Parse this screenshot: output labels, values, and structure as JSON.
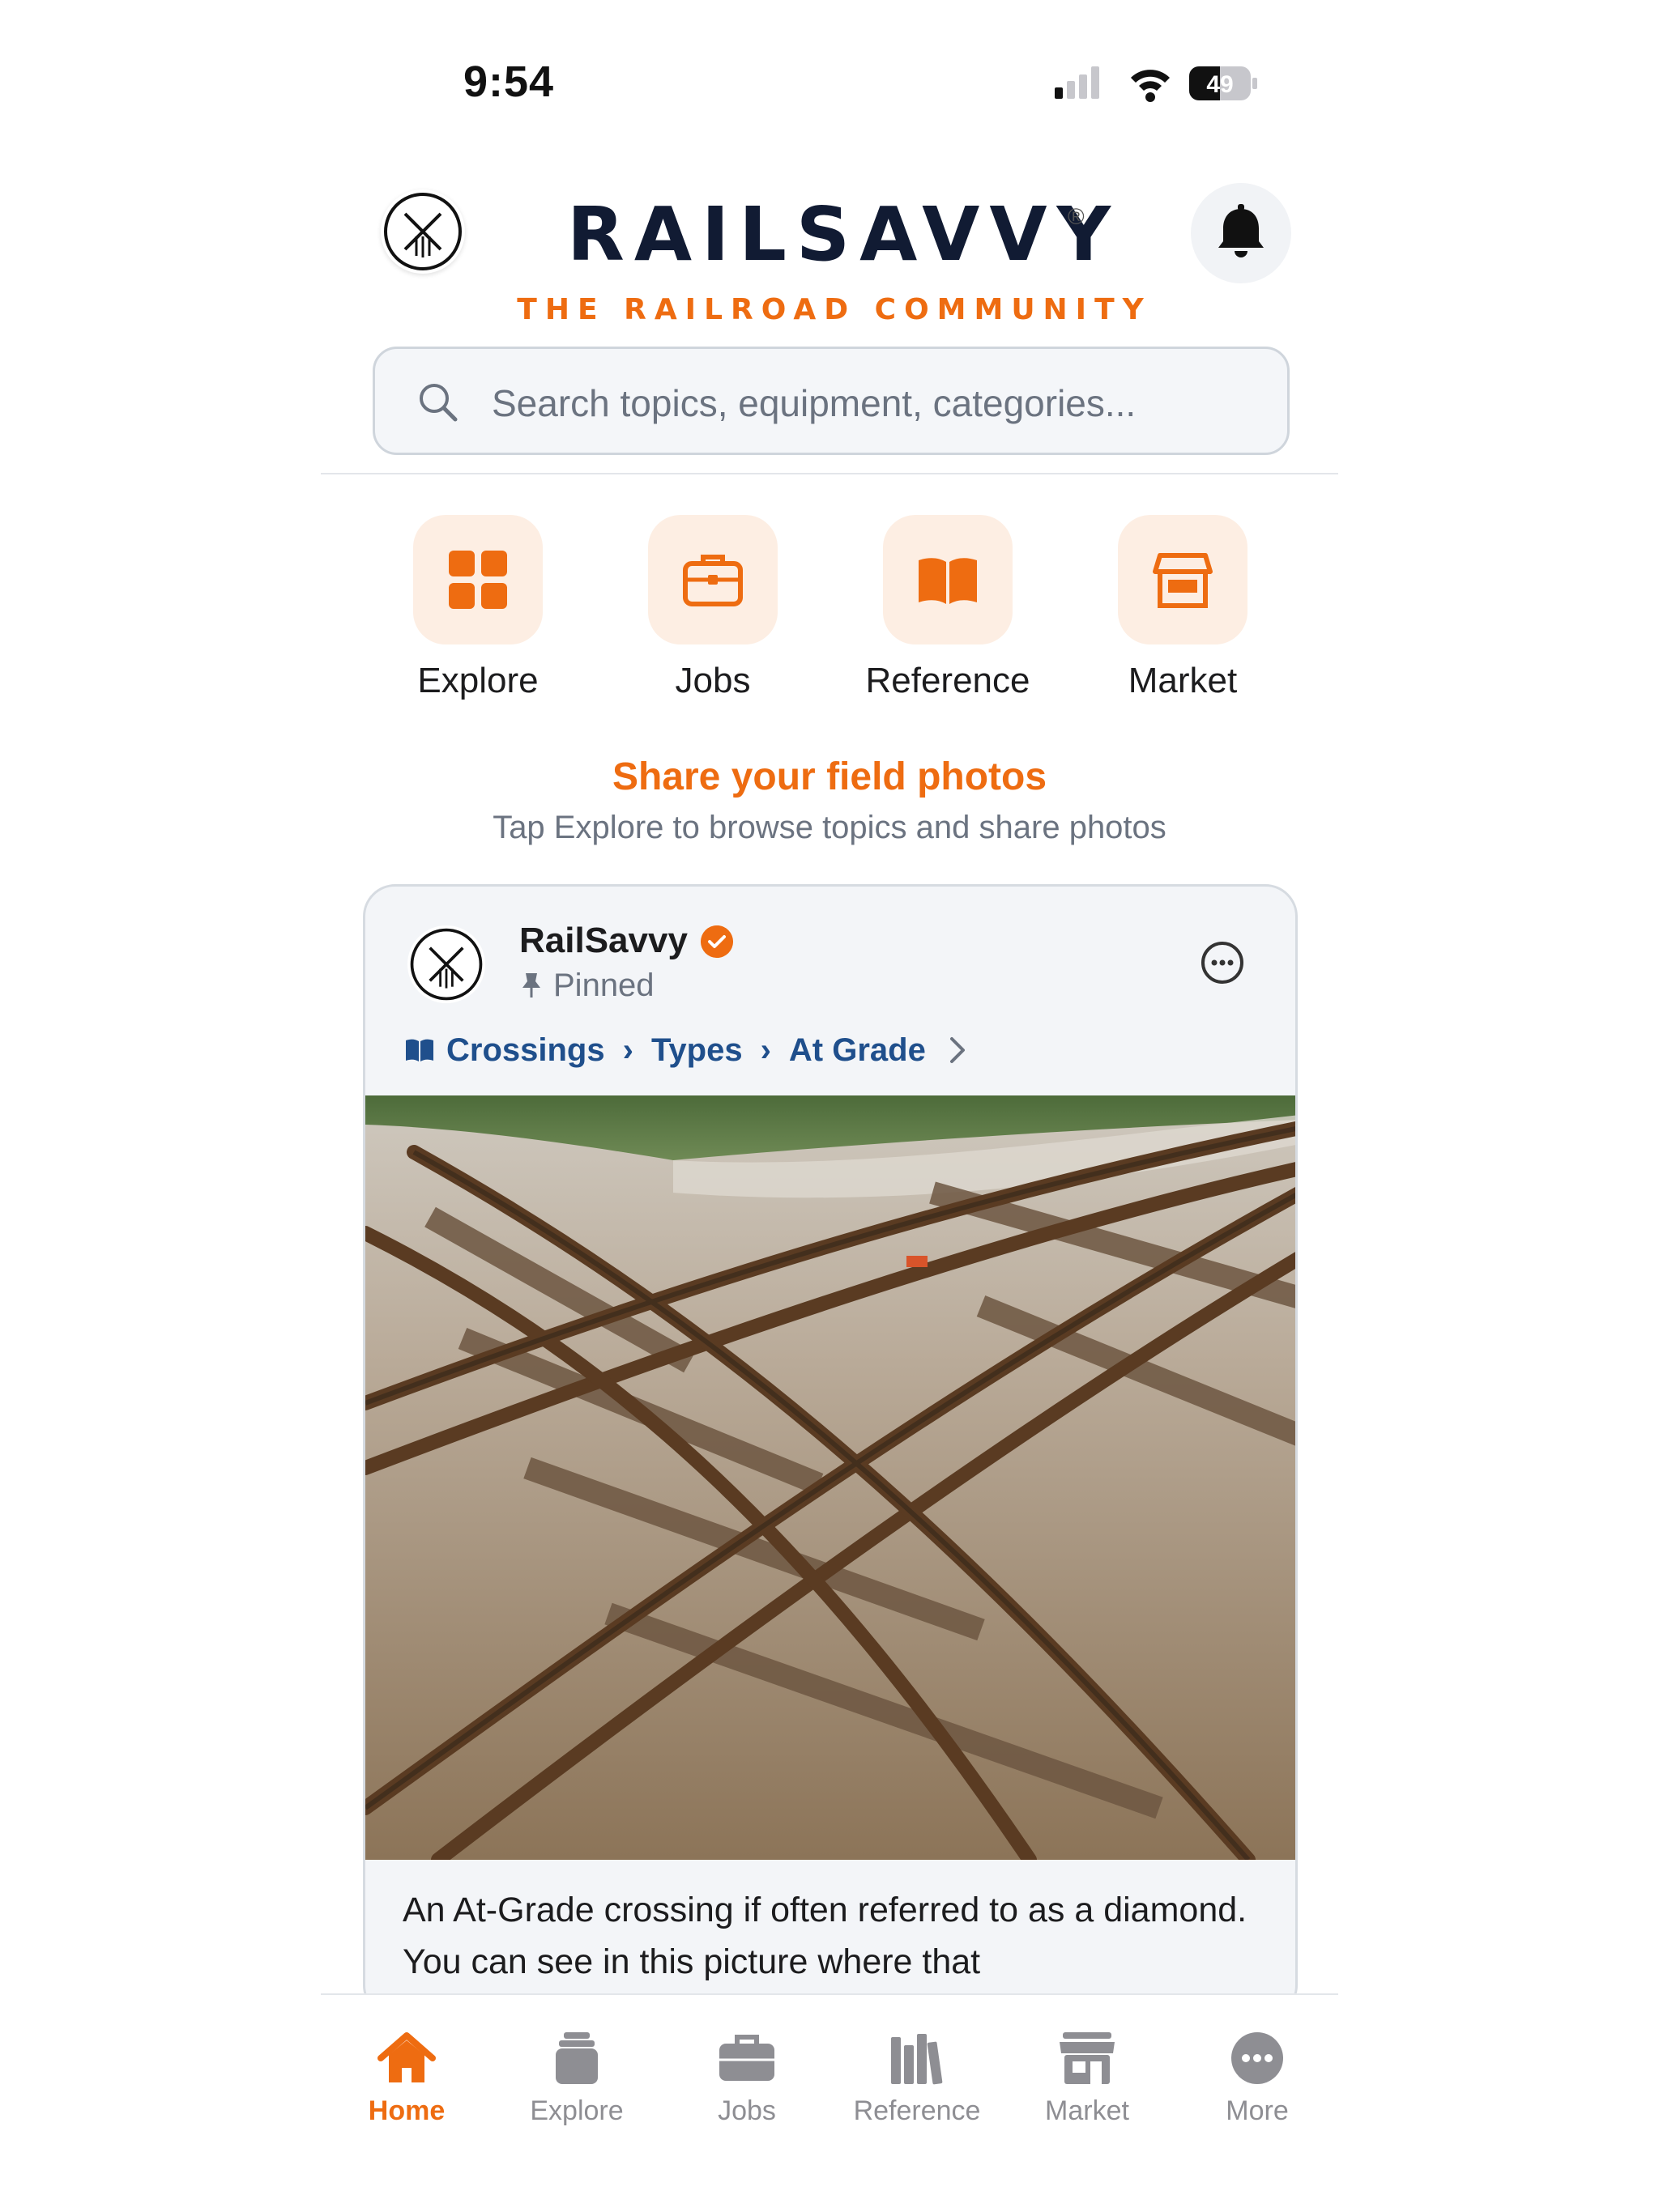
{
  "status_bar": {
    "time": "9:54",
    "battery": "49"
  },
  "header": {
    "brand": "RAILSAVVY",
    "registered": "®",
    "tagline": "THE RAILROAD COMMUNITY"
  },
  "search": {
    "placeholder": "Search topics, equipment, categories..."
  },
  "quick_links": [
    {
      "label": "Explore",
      "icon": "grid-icon"
    },
    {
      "label": "Jobs",
      "icon": "briefcase-icon"
    },
    {
      "label": "Reference",
      "icon": "book-icon"
    },
    {
      "label": "Market",
      "icon": "storefront-icon"
    }
  ],
  "promo": {
    "title": "Share your field photos",
    "subtitle": "Tap Explore to browse topics and share photos"
  },
  "post": {
    "author": "RailSavvy",
    "pinned": "Pinned",
    "breadcrumb": [
      "Crossings",
      "Types",
      "At Grade"
    ],
    "caption": "An At-Grade crossing if often referred to as a diamond. You can see in this picture where that"
  },
  "bottom_nav": [
    {
      "label": "Home",
      "icon": "home-icon",
      "active": true
    },
    {
      "label": "Explore",
      "icon": "layers-icon",
      "active": false
    },
    {
      "label": "Jobs",
      "icon": "briefcase-icon",
      "active": false
    },
    {
      "label": "Reference",
      "icon": "books-icon",
      "active": false
    },
    {
      "label": "Market",
      "icon": "storefront-icon",
      "active": false
    },
    {
      "label": "More",
      "icon": "ellipsis-icon",
      "active": false
    }
  ],
  "colors": {
    "accent": "#ee6c11",
    "brand_navy": "#111b33",
    "link_blue": "#1f4f8c"
  }
}
